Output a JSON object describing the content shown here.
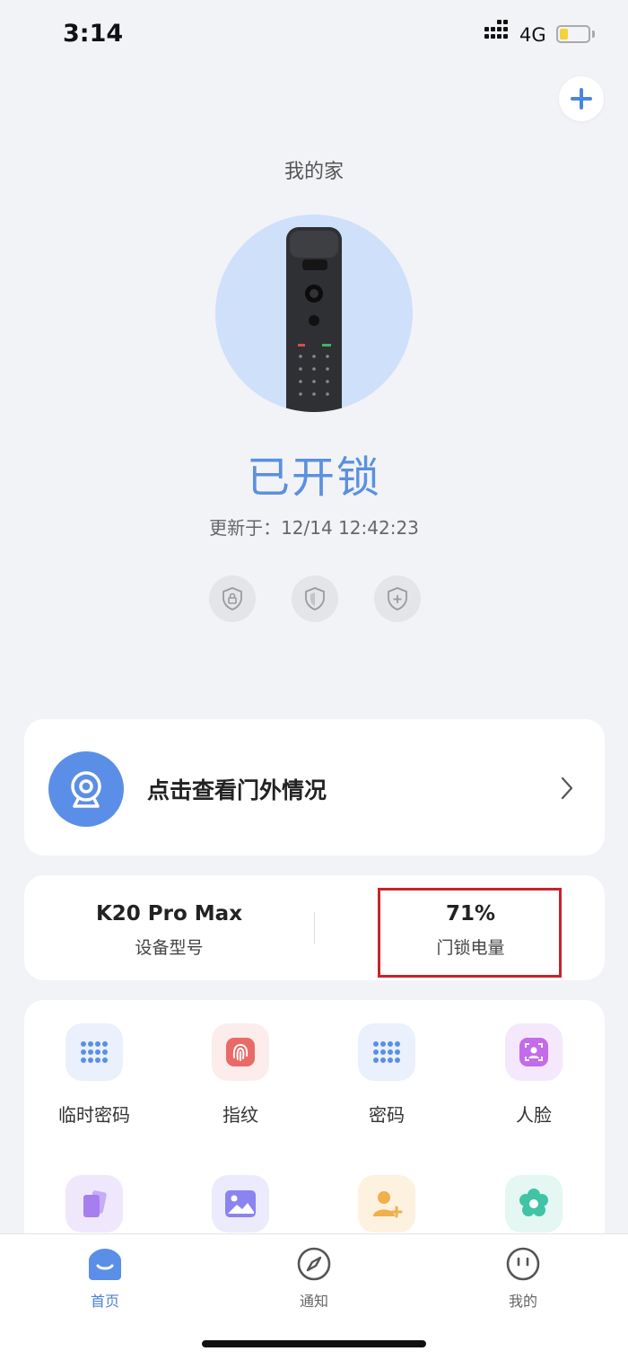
{
  "status_bar": {
    "time": "3:14",
    "network": "4G"
  },
  "header": {
    "home_title": "我的家"
  },
  "lock": {
    "status": "已开锁",
    "updated": "更新于：12/14 12:42:23"
  },
  "camera": {
    "label": "点击查看门外情况"
  },
  "device_info": {
    "model_value": "K20 Pro Max",
    "model_label": "设备型号",
    "battery_value": "71%",
    "battery_label": "门锁电量"
  },
  "features": [
    {
      "label": "临时密码",
      "icon": "keypad-icon",
      "color": "#5b8fe7"
    },
    {
      "label": "指纹",
      "icon": "fingerprint-icon",
      "color": "#ea6a67"
    },
    {
      "label": "密码",
      "icon": "keypad-icon",
      "color": "#5b8fe7"
    },
    {
      "label": "人脸",
      "icon": "face-scan-icon",
      "color": "#c46bea"
    },
    {
      "label": "",
      "icon": "card-icon",
      "color": "#a77ef0"
    },
    {
      "label": "",
      "icon": "image-icon",
      "color": "#8b84f0"
    },
    {
      "label": "",
      "icon": "add-user-icon",
      "color": "#f0b04a"
    },
    {
      "label": "",
      "icon": "settings-flower-icon",
      "color": "#41c3a6"
    }
  ],
  "tabs": [
    {
      "label": "首页",
      "icon": "home-icon",
      "active": true
    },
    {
      "label": "通知",
      "icon": "compass-icon",
      "active": false
    },
    {
      "label": "我的",
      "icon": "profile-icon",
      "active": false
    }
  ],
  "colors": {
    "accent": "#5b90e0",
    "highlight": "#c8232b"
  }
}
